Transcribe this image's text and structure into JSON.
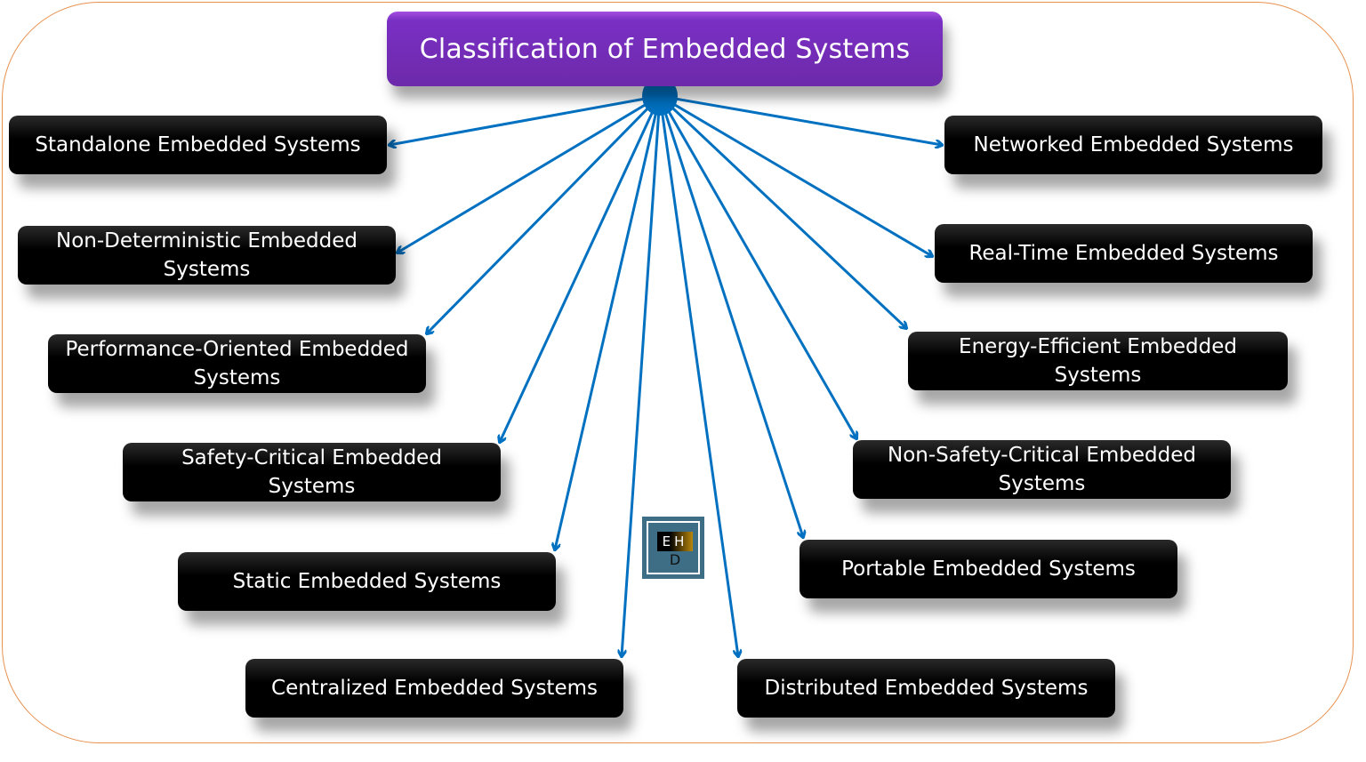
{
  "title": "Classification of Embedded Systems",
  "colors": {
    "title_bg": "#7030a0",
    "node_bg": "#000000",
    "connector": "#0070c0",
    "frame": "#e8914f"
  },
  "logo": {
    "top": "EH",
    "bottom": "D"
  },
  "left_nodes": [
    "Standalone Embedded Systems",
    "Non-Deterministic Embedded Systems",
    "Performance-Oriented Embedded Systems",
    "Safety-Critical Embedded Systems",
    "Static Embedded Systems",
    "Centralized Embedded Systems"
  ],
  "right_nodes": [
    "Networked Embedded Systems",
    "Real-Time Embedded Systems",
    "Energy-Efficient Embedded Systems",
    "Non-Safety-Critical Embedded Systems",
    "Portable Embedded Systems",
    "Distributed Embedded Systems"
  ]
}
